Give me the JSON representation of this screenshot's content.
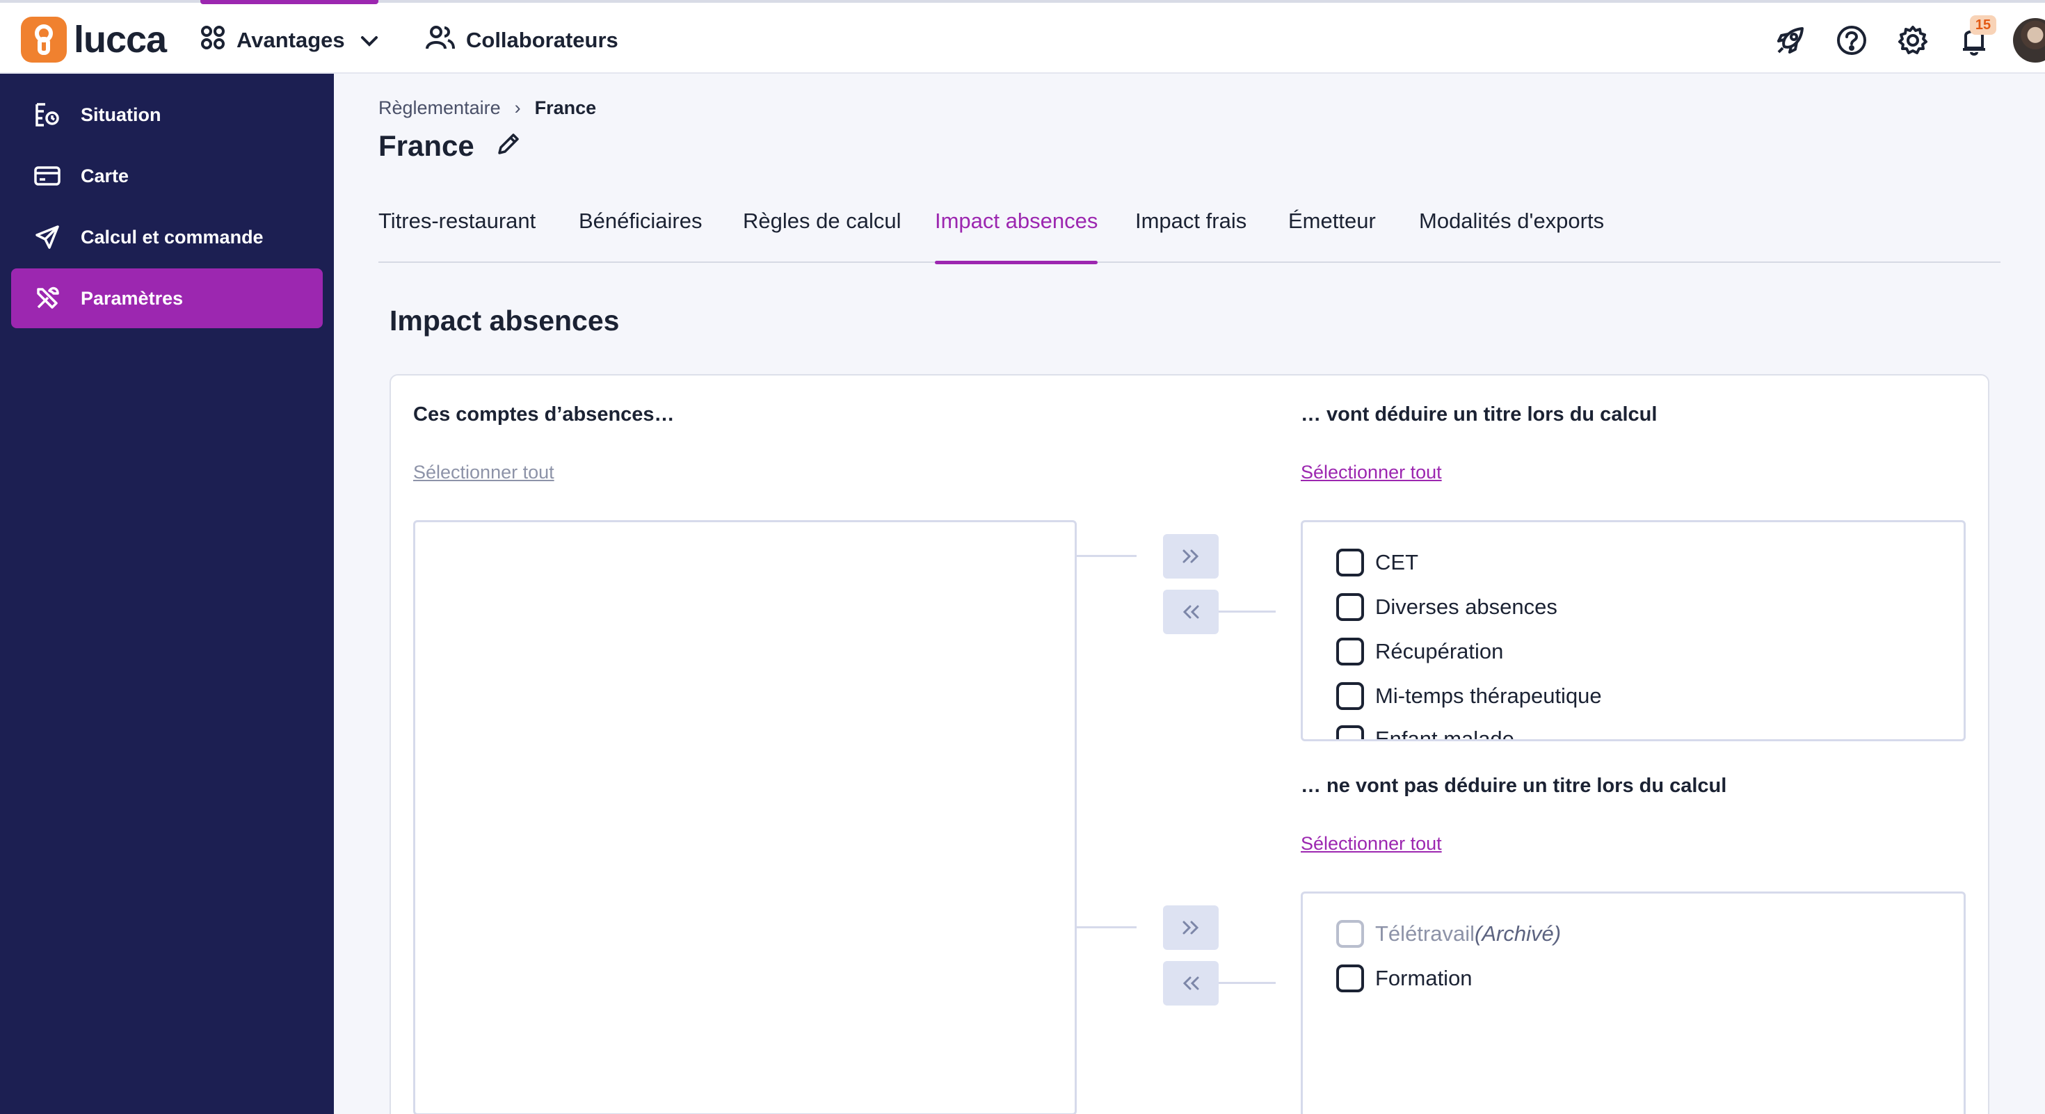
{
  "app": {
    "logo_text": "lucca",
    "brand_color": "#9c27b0",
    "sidebar_color": "#1c1f52",
    "logo_color": "#f0812f"
  },
  "topnav": {
    "avantages_label": "Avantages",
    "collaborateurs_label": "Collaborateurs",
    "notification_count": "15",
    "icons": [
      "rocket-icon",
      "help-icon",
      "gear-icon",
      "bell-icon"
    ]
  },
  "sidebar": {
    "items": [
      {
        "label": "Situation",
        "icon": "situation-icon"
      },
      {
        "label": "Carte",
        "icon": "card-icon"
      },
      {
        "label": "Calcul et commande",
        "icon": "send-icon"
      },
      {
        "label": "Paramètres",
        "icon": "tools-icon",
        "active": true
      }
    ]
  },
  "breadcrumb": {
    "parent": "Règlementaire",
    "separator": "›",
    "current": "France"
  },
  "page": {
    "title": "France"
  },
  "tabs": [
    {
      "label": "Titres-restaurant"
    },
    {
      "label": "Bénéficiaires"
    },
    {
      "label": "Règles de calcul"
    },
    {
      "label": "Impact absences",
      "active": true
    },
    {
      "label": "Impact frais"
    },
    {
      "label": "Émetteur"
    },
    {
      "label": "Modalités d'exports"
    }
  ],
  "section": {
    "title": "Impact absences",
    "left_title": "Ces comptes d’absences…",
    "left_select_all": "Sélectionner tout",
    "deduct_title": "… vont déduire un titre lors du calcul",
    "deduct_select_all": "Sélectionner tout",
    "deduct_items": [
      "CET",
      "Diverses absences",
      "Récupération",
      "Mi-temps thérapeutique",
      "Enfant malade"
    ],
    "nodeduct_title": "… ne vont pas déduire un titre lors du calcul",
    "nodeduct_select_all": "Sélectionner tout",
    "nodeduct_items": [
      {
        "label": "Télétravail",
        "tag": "(Archivé)",
        "archived": true
      },
      {
        "label": "Formation",
        "archived": false
      }
    ]
  }
}
